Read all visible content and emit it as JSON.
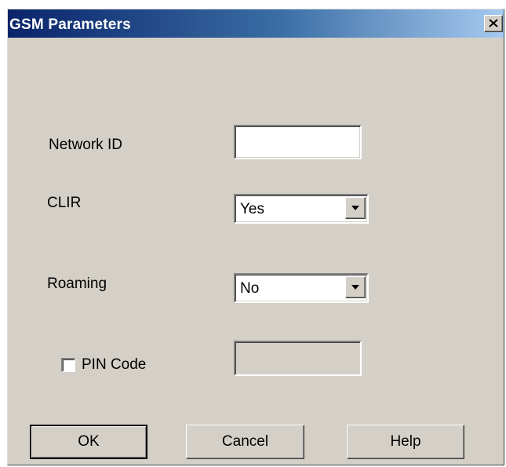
{
  "dialog": {
    "title": "GSM Parameters",
    "close_glyph": "✕"
  },
  "form": {
    "network_id": {
      "label": "Network ID",
      "value": ""
    },
    "clir": {
      "label": "CLIR",
      "value": "Yes"
    },
    "roaming": {
      "label": "Roaming",
      "value": "No"
    },
    "pin_code": {
      "label": "PIN Code",
      "checked": false,
      "value": "",
      "enabled": false
    }
  },
  "buttons": {
    "ok": "OK",
    "cancel": "Cancel",
    "help": "Help"
  },
  "icons": {
    "close": "close-icon",
    "dropdown": "chevron-down-icon"
  },
  "colors": {
    "face": "#d4d0c8",
    "title_start": "#0a246a",
    "title_end": "#a6caf0",
    "title_text": "#ffffff"
  }
}
